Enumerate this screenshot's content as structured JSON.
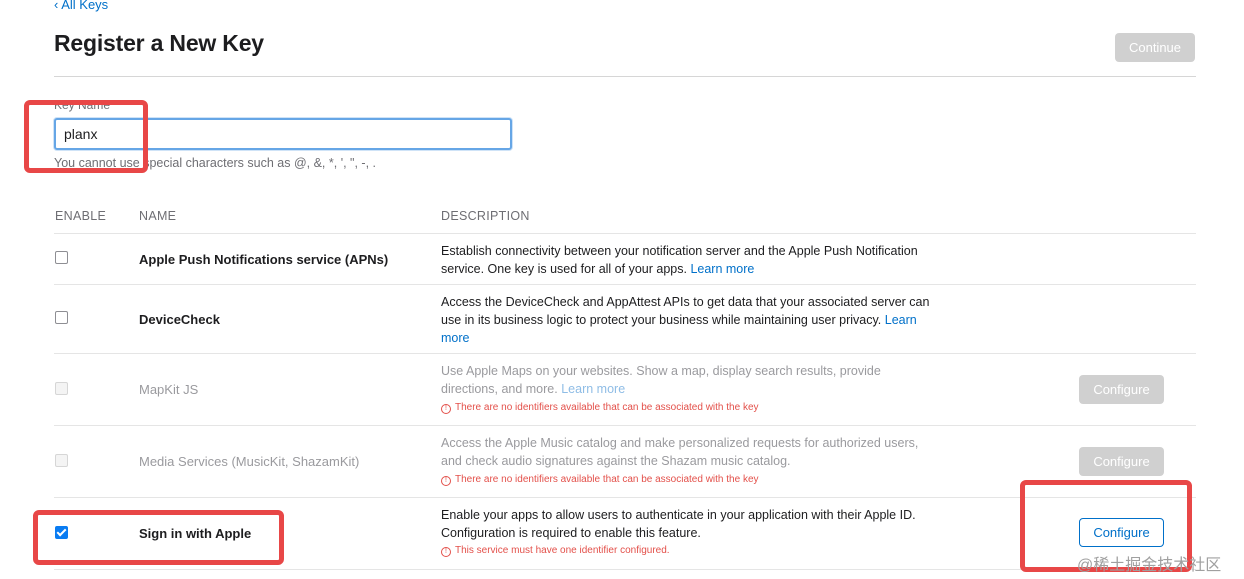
{
  "nav": {
    "back_label": "‹ All Keys"
  },
  "header": {
    "title": "Register a New Key",
    "continue_label": "Continue"
  },
  "form": {
    "key_name_label": "Key Name",
    "key_name_value": "planx",
    "hint": "You cannot use special characters such as @, &, *, ', \", -, ."
  },
  "table": {
    "headers": {
      "enable": "ENABLE",
      "name": "NAME",
      "description": "DESCRIPTION"
    },
    "rows": [
      {
        "name": "Apple Push Notifications service (APNs)",
        "desc": "Establish connectivity between your notification server and the Apple Push Notification service. One key is used for all of your apps.",
        "learn_more": "Learn more"
      },
      {
        "name": "DeviceCheck",
        "desc": "Access the DeviceCheck and AppAttest APIs to get data that your associated server can use in its business logic to protect your business while maintaining user privacy.",
        "learn_more": "Learn more"
      },
      {
        "name": "MapKit JS",
        "desc": "Use Apple Maps on your websites. Show a map, display search results, provide directions, and more.",
        "learn_more": "Learn more",
        "warning": "There are no identifiers available that can be associated with the key",
        "button": "Configure"
      },
      {
        "name": "Media Services (MusicKit, ShazamKit)",
        "desc": "Access the Apple Music catalog and make personalized requests for authorized users, and check audio signatures against the Shazam music catalog.",
        "warning": "There are no identifiers available that can be associated with the key",
        "button": "Configure"
      },
      {
        "name": "Sign in with Apple",
        "desc": "Enable your apps to allow users to authenticate in your application with their Apple ID. Configuration is required to enable this feature.",
        "warning": "This service must have one identifier configured.",
        "button": "Configure"
      }
    ]
  },
  "colors": {
    "accent": "#0070c9",
    "highlight": "#e84747",
    "warning": "#e3504a"
  },
  "watermark": "@稀土掘金技术社区"
}
